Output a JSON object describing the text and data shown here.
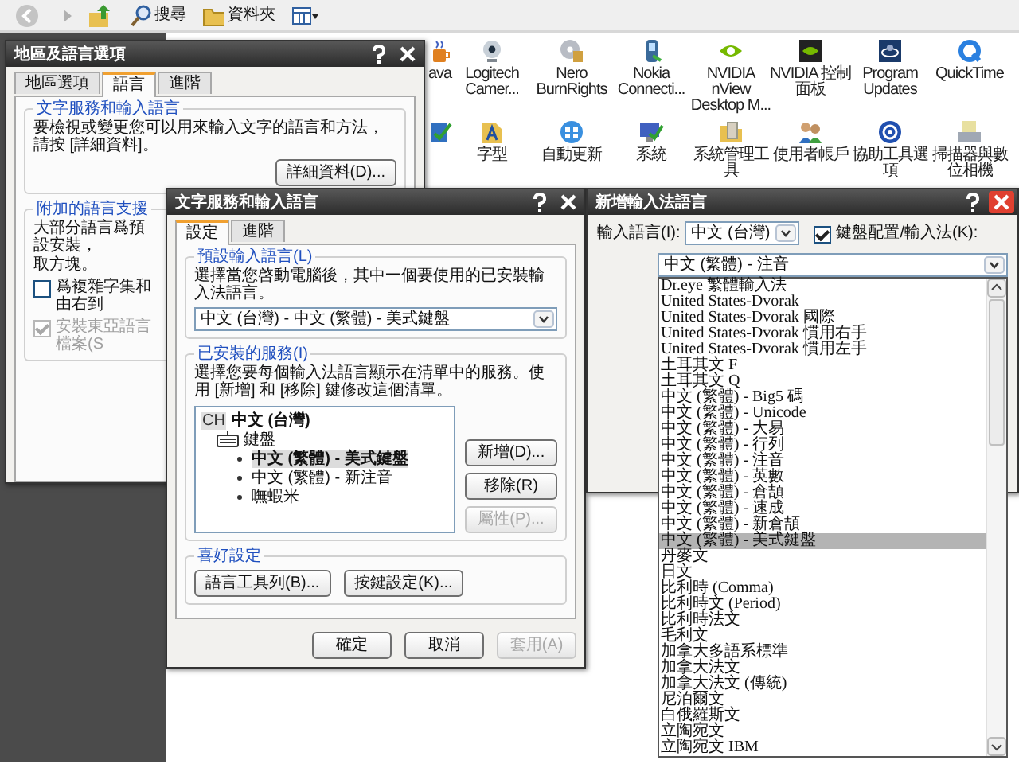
{
  "toolbar": {
    "items": [
      {
        "kind": "back"
      },
      {
        "kind": "forward"
      },
      {
        "kind": "up"
      },
      {
        "kind": "search",
        "label": "搜尋"
      },
      {
        "kind": "folders",
        "label": "資料夾"
      },
      {
        "kind": "views"
      }
    ]
  },
  "control_panel": {
    "rows": [
      [
        {
          "kind": "java",
          "label": "ava"
        },
        {
          "kind": "camera",
          "label": "Logitech Camer..."
        },
        {
          "kind": "disc",
          "label": "Nero BurnRights"
        },
        {
          "kind": "phone",
          "label": "Nokia Connecti..."
        },
        {
          "kind": "nvidia",
          "label": "NVIDIA nView Desktop M..."
        },
        {
          "kind": "nvidia-panel",
          "label": "NVIDIA 控制面板"
        },
        {
          "kind": "updates",
          "label": "Program Updates"
        },
        {
          "kind": "quicktime",
          "label": "QuickTime"
        }
      ],
      [
        {
          "kind": "network-check"
        },
        {
          "kind": "fonts",
          "label": "字型"
        },
        {
          "kind": "windows-update",
          "label": "自動更新"
        },
        {
          "kind": "system",
          "label": "系統"
        },
        {
          "kind": "admin-tools",
          "label": "系統管理工具"
        },
        {
          "kind": "users",
          "label": "使用者帳戶"
        },
        {
          "kind": "accessibility",
          "label": "協助工具選項"
        },
        {
          "kind": "scanner",
          "label": "掃描器與數位相機"
        }
      ]
    ]
  },
  "regional_dialog": {
    "title": "地區及語言選項",
    "active": false,
    "tabs": [
      {
        "label": "地區選項",
        "selected": false
      },
      {
        "label": "語言",
        "selected": true
      },
      {
        "label": "進階",
        "selected": false
      }
    ],
    "text_services": {
      "legend": "文字服務和輸入語言",
      "description": "要檢視或變更您可以用來輸入文字的語言和方法，請按 [詳細資料]。",
      "button": {
        "label": "詳細資料(D)...",
        "disabled": false
      }
    },
    "language_support": {
      "legend": "附加的語言支援",
      "lines": [
        "大部分語言爲預設安裝，",
        "取方塊。"
      ],
      "options": [
        {
          "label": "爲複雜字集和由右到",
          "checked": false,
          "disabled": false
        },
        {
          "label": "安裝東亞語言檔案(S",
          "checked": true,
          "disabled": true
        }
      ]
    }
  },
  "text_services_dialog": {
    "title": "文字服務和輸入語言",
    "active": false,
    "tabs": [
      {
        "label": "設定",
        "selected": true
      },
      {
        "label": "進階",
        "selected": false
      }
    ],
    "default_language": {
      "legend": "預設輸入語言(L)",
      "description": "選擇當您啓動電腦後，其中一個要使用的已安裝輸入法語言。",
      "value": "中文 (台灣) - 中文 (繁體) - 美式鍵盤"
    },
    "installed_services": {
      "legend": "已安裝的服務(I)",
      "description": "選擇您要每個輸入法語言顯示在清單中的服務。使用 [新增] 和 [移除] 鍵修改這個清單。",
      "tree": [
        {
          "kind": "language",
          "badge": "CH",
          "label": "中文 (台灣)",
          "children": [
            {
              "kind": "category",
              "label": "鍵盤",
              "children": [
                {
                  "kind": "service",
                  "label": "中文 (繁體) - 美式鍵盤",
                  "selected": true
                },
                {
                  "kind": "service",
                  "label": "中文 (繁體) - 新注音",
                  "selected": false
                },
                {
                  "kind": "service",
                  "label": "嘸蝦米",
                  "selected": false
                }
              ]
            }
          ]
        }
      ],
      "buttons": [
        {
          "label": "新增(D)...",
          "disabled": false
        },
        {
          "label": "移除(R)",
          "disabled": false
        },
        {
          "label": "屬性(P)...",
          "disabled": true
        }
      ]
    },
    "preferences": {
      "legend": "喜好設定",
      "buttons": [
        {
          "label": "語言工具列(B)...",
          "disabled": false
        },
        {
          "label": "按鍵設定(K)...",
          "disabled": false
        }
      ]
    },
    "footer_buttons": [
      {
        "label": "確定",
        "disabled": false
      },
      {
        "label": "取消",
        "disabled": false
      },
      {
        "label": "套用(A)",
        "disabled": true
      }
    ]
  },
  "add_language_dialog": {
    "title": "新增輸入法語言",
    "active": true,
    "language_label": "輸入語言(I):",
    "language_value": "中文 (台灣)",
    "layout_option": {
      "label": "鍵盤配置/輸入法(K):",
      "checked": true
    },
    "layout_value": "中文 (繁體) - 注音",
    "layout_list": [
      {
        "label": "Dr.eye 繁體輸入法",
        "selected": false
      },
      {
        "label": "United States-Dvorak",
        "selected": false
      },
      {
        "label": "United States-Dvorak 國際",
        "selected": false
      },
      {
        "label": "United States-Dvorak 慣用右手",
        "selected": false
      },
      {
        "label": "United States-Dvorak 慣用左手",
        "selected": false
      },
      {
        "label": "土耳其文 F",
        "selected": false
      },
      {
        "label": "土耳其文 Q",
        "selected": false
      },
      {
        "label": "中文 (繁體) - Big5 碼",
        "selected": false
      },
      {
        "label": "中文 (繁體) - Unicode",
        "selected": false
      },
      {
        "label": "中文 (繁體) - 大易",
        "selected": false
      },
      {
        "label": "中文 (繁體) - 行列",
        "selected": false
      },
      {
        "label": "中文 (繁體) - 注音",
        "selected": false
      },
      {
        "label": "中文 (繁體) - 英數",
        "selected": false
      },
      {
        "label": "中文 (繁體) - 倉頡",
        "selected": false
      },
      {
        "label": "中文 (繁體) - 速成",
        "selected": false
      },
      {
        "label": "中文 (繁體) - 新倉頡",
        "selected": false
      },
      {
        "label": "中文 (繁體) - 美式鍵盤",
        "selected": true
      },
      {
        "label": "丹麥文",
        "selected": false
      },
      {
        "label": "日文",
        "selected": false
      },
      {
        "label": "比利時 (Comma)",
        "selected": false
      },
      {
        "label": "比利時文 (Period)",
        "selected": false
      },
      {
        "label": "比利時法文",
        "selected": false
      },
      {
        "label": "毛利文",
        "selected": false
      },
      {
        "label": "加拿大多語系標準",
        "selected": false
      },
      {
        "label": "加拿大法文",
        "selected": false
      },
      {
        "label": "加拿大法文 (傳統)",
        "selected": false
      },
      {
        "label": "尼泊爾文",
        "selected": false
      },
      {
        "label": "白俄羅斯文",
        "selected": false
      },
      {
        "label": "立陶宛文",
        "selected": false
      },
      {
        "label": "立陶宛文 IBM",
        "selected": false
      }
    ]
  }
}
